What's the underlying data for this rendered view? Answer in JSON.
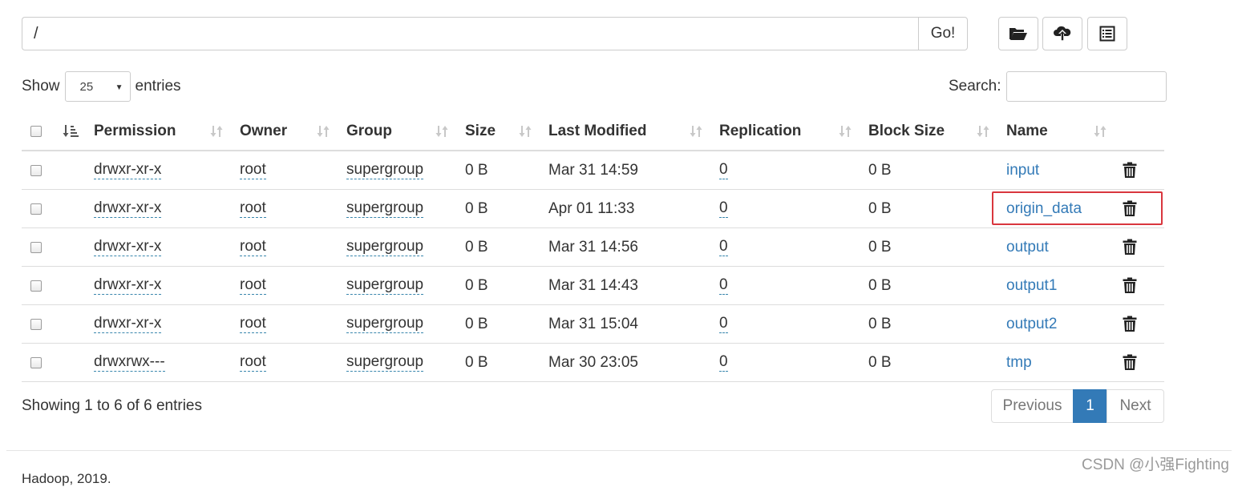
{
  "path": {
    "value": "/",
    "go_label": "Go!"
  },
  "toolbar": {
    "create_folder": "folder-open-icon",
    "upload": "cloud-upload-icon",
    "cut_paste": "list-alt-icon"
  },
  "length": {
    "show_label": "Show",
    "selected": "25",
    "entries_label": "entries"
  },
  "search": {
    "label": "Search:",
    "value": ""
  },
  "table": {
    "columns": [
      "Permission",
      "Owner",
      "Group",
      "Size",
      "Last Modified",
      "Replication",
      "Block Size",
      "Name"
    ],
    "rows": [
      {
        "permission": "drwxr-xr-x",
        "owner": "root",
        "group": "supergroup",
        "size": "0 B",
        "modified": "Mar 31 14:59",
        "replication": "0",
        "block_size": "0 B",
        "name": "input"
      },
      {
        "permission": "drwxr-xr-x",
        "owner": "root",
        "group": "supergroup",
        "size": "0 B",
        "modified": "Apr 01 11:33",
        "replication": "0",
        "block_size": "0 B",
        "name": "origin_data"
      },
      {
        "permission": "drwxr-xr-x",
        "owner": "root",
        "group": "supergroup",
        "size": "0 B",
        "modified": "Mar 31 14:56",
        "replication": "0",
        "block_size": "0 B",
        "name": "output"
      },
      {
        "permission": "drwxr-xr-x",
        "owner": "root",
        "group": "supergroup",
        "size": "0 B",
        "modified": "Mar 31 14:43",
        "replication": "0",
        "block_size": "0 B",
        "name": "output1"
      },
      {
        "permission": "drwxr-xr-x",
        "owner": "root",
        "group": "supergroup",
        "size": "0 B",
        "modified": "Mar 31 15:04",
        "replication": "0",
        "block_size": "0 B",
        "name": "output2"
      },
      {
        "permission": "drwxrwx---",
        "owner": "root",
        "group": "supergroup",
        "size": "0 B",
        "modified": "Mar 30 23:05",
        "replication": "0",
        "block_size": "0 B",
        "name": "tmp"
      }
    ]
  },
  "info": "Showing 1 to 6 of 6 entries",
  "pagination": {
    "previous": "Previous",
    "current": "1",
    "next": "Next"
  },
  "footer": {
    "copyright": "Hadoop, 2019."
  },
  "watermark": "CSDN @小强Fighting",
  "colors": {
    "link": "#337ab7",
    "active_page": "#337ab7",
    "highlight_border": "#d9363e",
    "dashed_underline": "#3a87ad"
  }
}
